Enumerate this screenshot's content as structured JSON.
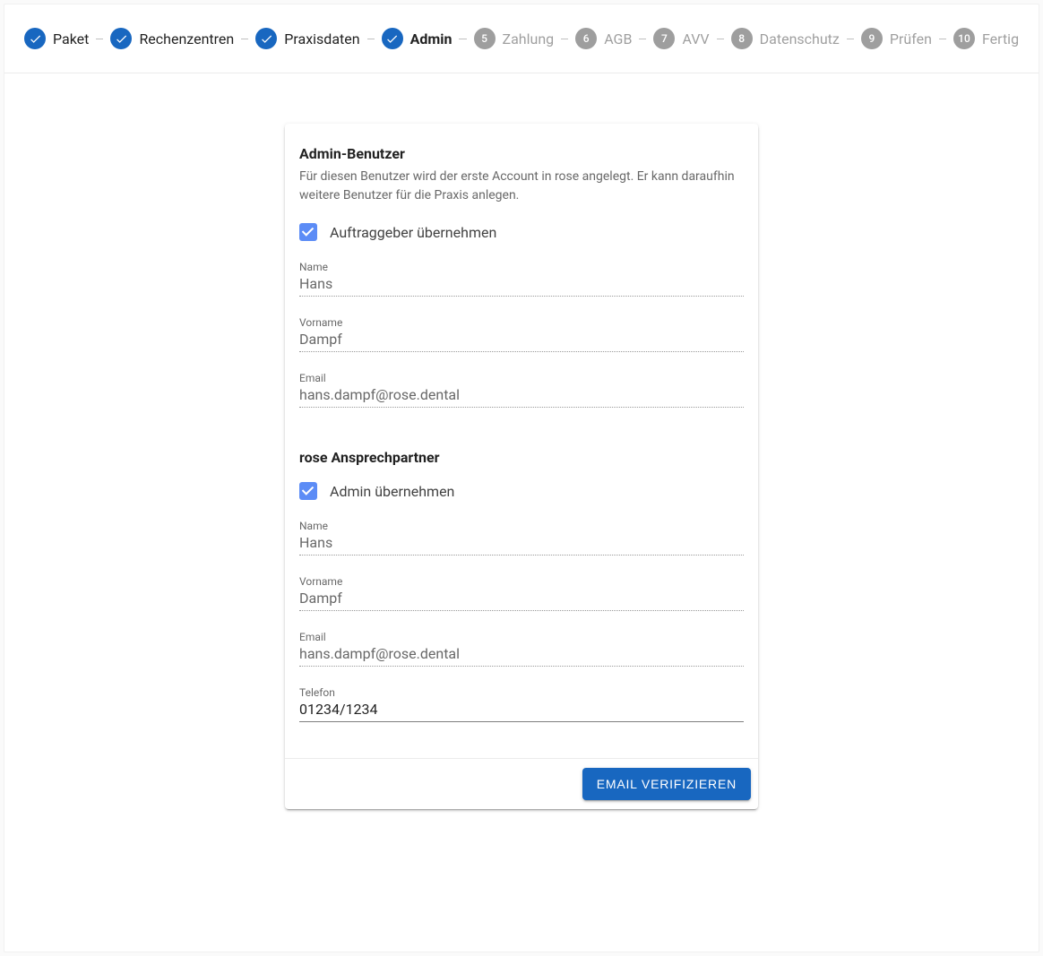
{
  "stepper": {
    "steps": [
      {
        "label": "Paket",
        "state": "completed"
      },
      {
        "label": "Rechenzentren",
        "state": "completed"
      },
      {
        "label": "Praxisdaten",
        "state": "completed"
      },
      {
        "label": "Admin",
        "state": "current"
      },
      {
        "label": "Zahlung",
        "state": "pending",
        "num": "5"
      },
      {
        "label": "AGB",
        "state": "pending",
        "num": "6"
      },
      {
        "label": "AVV",
        "state": "pending",
        "num": "7"
      },
      {
        "label": "Datenschutz",
        "state": "pending",
        "num": "8"
      },
      {
        "label": "Prüfen",
        "state": "pending",
        "num": "9"
      },
      {
        "label": "Fertig",
        "state": "pending",
        "num": "10"
      }
    ]
  },
  "card": {
    "section1": {
      "title": "Admin-Benutzer",
      "desc": "Für diesen Benutzer wird der erste Account in rose angelegt. Er kann daraufhin weitere Benutzer für die Praxis anlegen.",
      "checkbox_label": "Auftraggeber übernehmen",
      "fields": {
        "name_label": "Name",
        "name_value": "Hans",
        "vorname_label": "Vorname",
        "vorname_value": "Dampf",
        "email_label": "Email",
        "email_value": "hans.dampf@rose.dental"
      }
    },
    "section2": {
      "title": "rose Ansprechpartner",
      "checkbox_label": "Admin übernehmen",
      "fields": {
        "name_label": "Name",
        "name_value": "Hans",
        "vorname_label": "Vorname",
        "vorname_value": "Dampf",
        "email_label": "Email",
        "email_value": "hans.dampf@rose.dental",
        "telefon_label": "Telefon",
        "telefon_value": "01234/1234"
      }
    },
    "actions": {
      "verify_label": "Email verifizieren"
    }
  }
}
